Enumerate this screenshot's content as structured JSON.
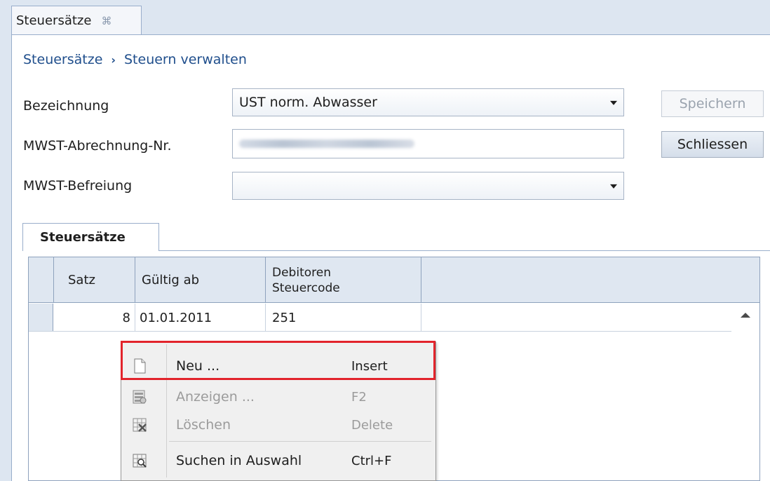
{
  "doc_tab": {
    "title": "Steuersätze",
    "close_glyph": "⌘"
  },
  "breadcrumb": {
    "root": "Steuersätze",
    "separator": "›",
    "current": "Steuern verwalten"
  },
  "form": {
    "bezeichnung": {
      "label": "Bezeichnung",
      "value": "UST norm. Abwasser"
    },
    "mwst_nr": {
      "label": "MWST-Abrechnung-Nr.",
      "value": ""
    },
    "befreiung": {
      "label": "MWST-Befreiung",
      "value": ""
    }
  },
  "buttons": {
    "save": "Speichern",
    "close": "Schliessen"
  },
  "sub_tab": {
    "label": "Steuersätze"
  },
  "grid": {
    "columns": [
      "Satz",
      "Gültig ab",
      "Debitoren",
      "Steuercode"
    ],
    "rows": [
      {
        "satz": "8",
        "gueltig_ab": "01.01.2011",
        "steuercode": "251"
      }
    ]
  },
  "context_menu": {
    "items": [
      {
        "label": "Neu ...",
        "shortcut": "Insert",
        "enabled": true,
        "icon": "new-document-icon"
      },
      {
        "label": "Anzeigen ...",
        "shortcut": "F2",
        "enabled": false,
        "icon": "view-form-icon"
      },
      {
        "label": "Löschen",
        "shortcut": "Delete",
        "enabled": false,
        "icon": "delete-grid-icon"
      },
      {
        "label": "Suchen in Auswahl",
        "shortcut": "Ctrl+F",
        "enabled": true,
        "icon": "search-grid-icon"
      }
    ],
    "highlight_color": "#e2242c"
  }
}
